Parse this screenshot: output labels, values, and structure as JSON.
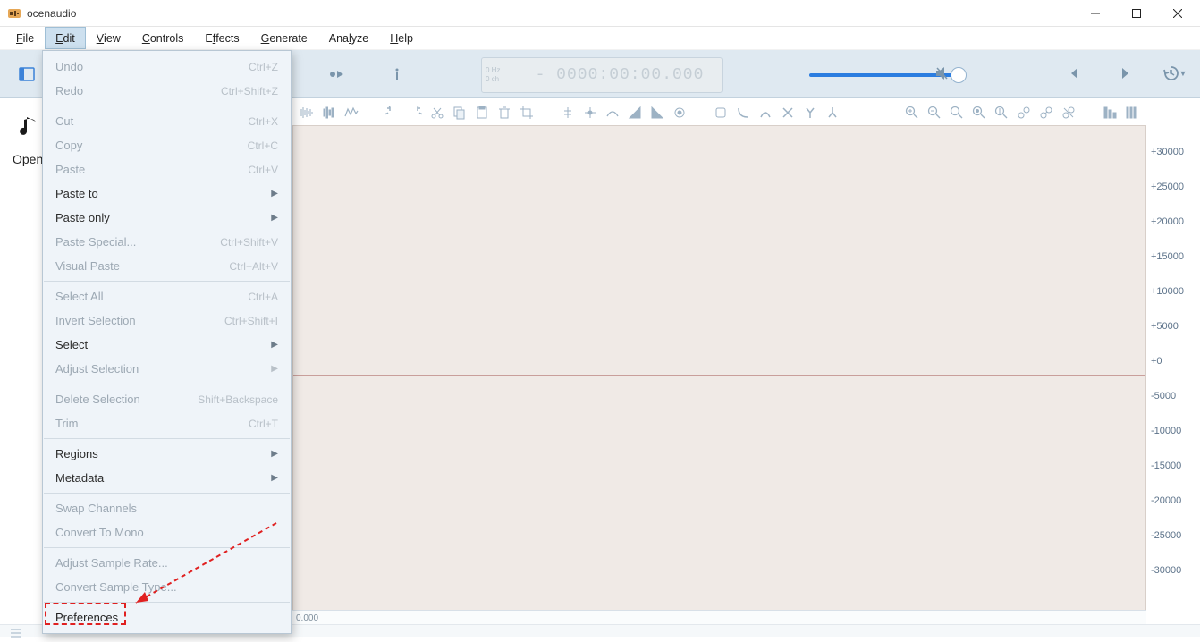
{
  "app": {
    "title": "ocenaudio"
  },
  "menubar": [
    "File",
    "Edit",
    "View",
    "Controls",
    "Effects",
    "Generate",
    "Analyze",
    "Help"
  ],
  "menubar_underline_idx": [
    0,
    0,
    0,
    0,
    1,
    0,
    3,
    0
  ],
  "active_menu_index": 1,
  "lcd": {
    "hz": "0 Hz",
    "ch": "0 ch",
    "time": "- 0000:00:00.000"
  },
  "side": {
    "label": "Open"
  },
  "time_ruler_zero": "0.000",
  "ruler_values": [
    "+30000",
    "+25000",
    "+20000",
    "+15000",
    "+10000",
    "+5000",
    "+0",
    "-5000",
    "-10000",
    "-15000",
    "-20000",
    "-25000",
    "-30000"
  ],
  "edit_menu": [
    {
      "type": "item",
      "label": "Undo",
      "shortcut": "Ctrl+Z",
      "disabled": true,
      "name": "menu-undo"
    },
    {
      "type": "item",
      "label": "Redo",
      "shortcut": "Ctrl+Shift+Z",
      "disabled": true,
      "name": "menu-redo"
    },
    {
      "type": "sep"
    },
    {
      "type": "item",
      "label": "Cut",
      "shortcut": "Ctrl+X",
      "disabled": true,
      "name": "menu-cut"
    },
    {
      "type": "item",
      "label": "Copy",
      "shortcut": "Ctrl+C",
      "disabled": true,
      "name": "menu-copy"
    },
    {
      "type": "item",
      "label": "Paste",
      "shortcut": "Ctrl+V",
      "disabled": true,
      "name": "menu-paste"
    },
    {
      "type": "sub",
      "label": "Paste to",
      "name": "menu-paste-to"
    },
    {
      "type": "sub",
      "label": "Paste only",
      "name": "menu-paste-only"
    },
    {
      "type": "item",
      "label": "Paste Special...",
      "shortcut": "Ctrl+Shift+V",
      "disabled": true,
      "name": "menu-paste-special"
    },
    {
      "type": "item",
      "label": "Visual Paste",
      "shortcut": "Ctrl+Alt+V",
      "disabled": true,
      "name": "menu-visual-paste"
    },
    {
      "type": "sep"
    },
    {
      "type": "item",
      "label": "Select All",
      "shortcut": "Ctrl+A",
      "disabled": true,
      "name": "menu-select-all"
    },
    {
      "type": "item",
      "label": "Invert Selection",
      "shortcut": "Ctrl+Shift+I",
      "disabled": true,
      "name": "menu-invert-selection"
    },
    {
      "type": "sub",
      "label": "Select",
      "name": "menu-select"
    },
    {
      "type": "sub",
      "label": "Adjust Selection",
      "disabled": true,
      "name": "menu-adjust-selection"
    },
    {
      "type": "sep"
    },
    {
      "type": "item",
      "label": "Delete Selection",
      "shortcut": "Shift+Backspace",
      "disabled": true,
      "name": "menu-delete-selection"
    },
    {
      "type": "item",
      "label": "Trim",
      "shortcut": "Ctrl+T",
      "disabled": true,
      "name": "menu-trim"
    },
    {
      "type": "sep"
    },
    {
      "type": "sub",
      "label": "Regions",
      "name": "menu-regions"
    },
    {
      "type": "sub",
      "label": "Metadata",
      "name": "menu-metadata"
    },
    {
      "type": "sep"
    },
    {
      "type": "item",
      "label": "Swap Channels",
      "disabled": true,
      "name": "menu-swap-channels"
    },
    {
      "type": "item",
      "label": "Convert To Mono",
      "disabled": true,
      "name": "menu-convert-mono"
    },
    {
      "type": "sep"
    },
    {
      "type": "item",
      "label": "Adjust Sample Rate...",
      "disabled": true,
      "name": "menu-adjust-sample-rate"
    },
    {
      "type": "item",
      "label": "Convert Sample Type...",
      "disabled": true,
      "name": "menu-convert-sample-type"
    },
    {
      "type": "sep"
    },
    {
      "type": "item",
      "label": "Preferences",
      "name": "menu-preferences"
    }
  ]
}
